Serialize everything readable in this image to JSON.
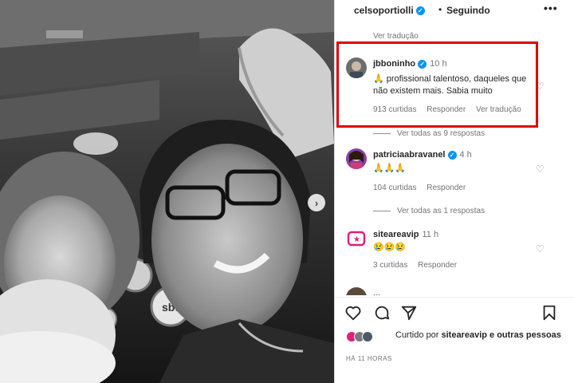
{
  "header": {
    "username": "celsoportiolli",
    "separator": "•",
    "follow_status": "Seguindo",
    "more_label": "•••"
  },
  "photo": {
    "logo_text": "sbt",
    "next_label": "›"
  },
  "comments": {
    "top_translation": "Ver tradução",
    "items": [
      {
        "username": "jbboninho",
        "time": "10 h",
        "emoji": "🙏",
        "text": "profissional talentoso, daqueles que não existem mais. Sabia muito",
        "likes": "913 curtidas",
        "reply": "Responder",
        "translate": "Ver tradução",
        "view_replies": "Ver todas as 9 respostas"
      },
      {
        "username": "patriciaabravanel",
        "time": "4 h",
        "text": "🙏🙏🙏",
        "likes": "104 curtidas",
        "reply": "Responder",
        "view_replies": "Ver todas as 1 respostas"
      },
      {
        "username": "siteareavip",
        "time": "11 h",
        "text": "😢😢😢",
        "likes": "3 curtidas",
        "reply": "Responder"
      },
      {
        "username": "..."
      }
    ]
  },
  "actions": {
    "liked_prefix": "Curtido por",
    "liked_user": "siteareavip",
    "liked_suffix": "e outras pessoas",
    "time_ago": "HÁ 11 HORAS"
  },
  "colors": {
    "verified": "#0095f6",
    "highlight": "#e00000",
    "meta": "#737373"
  }
}
